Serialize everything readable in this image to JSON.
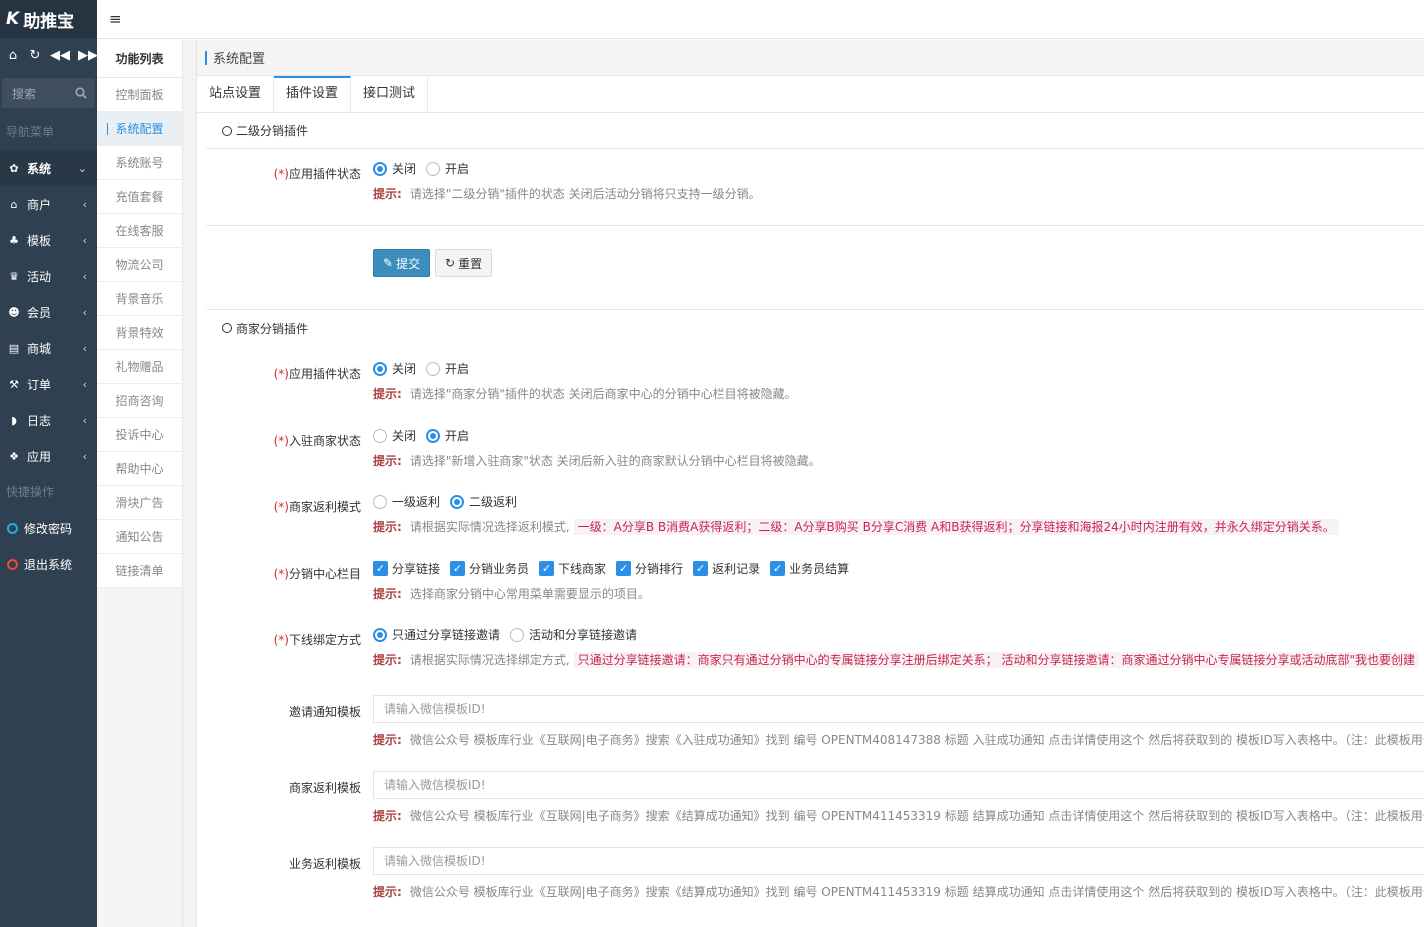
{
  "brand": {
    "logo_letter": "K",
    "name": "助推宝"
  },
  "sidebar": {
    "search_placeholder": "搜索",
    "nav_section": "导航菜单",
    "menu": [
      {
        "label": "系统",
        "icon": "gear-icon",
        "glyph": "✿",
        "active": true,
        "arrow": "⌄"
      },
      {
        "label": "商户",
        "icon": "home-icon",
        "glyph": "⌂",
        "arrow": "‹"
      },
      {
        "label": "模板",
        "icon": "sitemap-icon",
        "glyph": "♣",
        "arrow": "‹"
      },
      {
        "label": "活动",
        "icon": "trophy-icon",
        "glyph": "♛",
        "arrow": "‹"
      },
      {
        "label": "会员",
        "icon": "users-icon",
        "glyph": "☻",
        "arrow": "‹"
      },
      {
        "label": "商城",
        "icon": "cart-icon",
        "glyph": "▤",
        "arrow": "‹"
      },
      {
        "label": "订单",
        "icon": "gavel-icon",
        "glyph": "⚒",
        "arrow": "‹"
      },
      {
        "label": "日志",
        "icon": "shield-icon",
        "glyph": "◗",
        "arrow": "‹"
      },
      {
        "label": "应用",
        "icon": "cubes-icon",
        "glyph": "❖",
        "arrow": "‹"
      }
    ],
    "quick_section": "快捷操作",
    "quick": [
      {
        "label": "修改密码",
        "color": "#1ab0e6"
      },
      {
        "label": "退出系统",
        "color": "#e84c3d"
      }
    ]
  },
  "topbar": {
    "menu_glyph": "≡"
  },
  "subnav": {
    "title": "功能列表",
    "items": [
      "控制面板",
      "系统配置",
      "系统账号",
      "充值套餐",
      "在线客服",
      "物流公司",
      "背景音乐",
      "背景特效",
      "礼物赠品",
      "招商咨询",
      "投诉中心",
      "帮助中心",
      "滑块广告",
      "通知公告",
      "链接清单"
    ],
    "active_index": 1
  },
  "page": {
    "header": "系统配置",
    "tabs": [
      "站点设置",
      "插件设置",
      "接口测试"
    ],
    "active_tab": 1
  },
  "sec1": {
    "title": "二级分销插件",
    "status_label": "应用插件状态",
    "req": "(*)",
    "opt_off": "关闭",
    "opt_on": "开启",
    "hint_label": "提示:",
    "hint": "请选择\"二级分销\"插件的状态 关闭后活动分销将只支持一级分销。",
    "submit": "提交",
    "reset": "重置"
  },
  "sec2": {
    "title": "商家分销插件",
    "req": "(*)",
    "hint_label": "提示:",
    "f1": {
      "label": "应用插件状态",
      "off": "关闭",
      "on": "开启",
      "hint": "请选择\"商家分销\"插件的状态 关闭后商家中心的分销中心栏目将被隐藏。"
    },
    "f2": {
      "label": "入驻商家状态",
      "off": "关闭",
      "on": "开启",
      "hint": "请选择\"新增入驻商家\"状态 关闭后新入驻的商家默认分销中心栏目将被隐藏。"
    },
    "f3": {
      "label": "商家返利模式",
      "opt1": "一级返利",
      "opt2": "二级返利",
      "hint": "请根据实际情况选择返利模式,",
      "hint_red": "一级：A分享B B消费A获得返利；二级：A分享B购买 B分享C消费 A和B获得返利；分享链接和海报24小时内注册有效，并永久绑定分销关系。"
    },
    "f4": {
      "label": "分销中心栏目",
      "checks": [
        "分享链接",
        "分销业务员",
        "下线商家",
        "分销排行",
        "返利记录",
        "业务员结算"
      ],
      "hint": "选择商家分销中心常用菜单需要显示的项目。"
    },
    "f5": {
      "label": "下线绑定方式",
      "opt1": "只通过分享链接邀请",
      "opt2": "活动和分享链接邀请",
      "hint": "请根据实际情况选择绑定方式,",
      "hint_red": "只通过分享链接邀请：商家只有通过分销中心的专属链接分享注册后绑定关系；  活动和分享链接邀请：商家通过分销中心专属链接分享或活动底部\"我也要创建"
    },
    "f6": {
      "label": "邀请通知模板",
      "placeholder": "请输入微信模板ID!",
      "hint": "微信公众号 模板库行业《互联网|电子商务》搜索《入驻成功通知》找到 编号 OPENTM408147388 标题 入驻成功通知 点击详情使用这个 然后将获取到的 模板ID写入表格中。（注：此模板用于"
    },
    "f7": {
      "label": "商家返利模板",
      "placeholder": "请输入微信模板ID!",
      "hint": "微信公众号 模板库行业《互联网|电子商务》搜索《结算成功通知》找到 编号 OPENTM411453319 标题 结算成功通知 点击详情使用这个 然后将获取到的 模板ID写入表格中。（注：此模板用于"
    },
    "f8": {
      "label": "业务返利模板",
      "placeholder": "请输入微信模板ID!",
      "hint": "微信公众号 模板库行业《互联网|电子商务》搜索《结算成功通知》找到 编号 OPENTM411453319 标题 结算成功通知 点击详情使用这个 然后将获取到的 模板ID写入表格中。（注：此模板用于"
    }
  }
}
